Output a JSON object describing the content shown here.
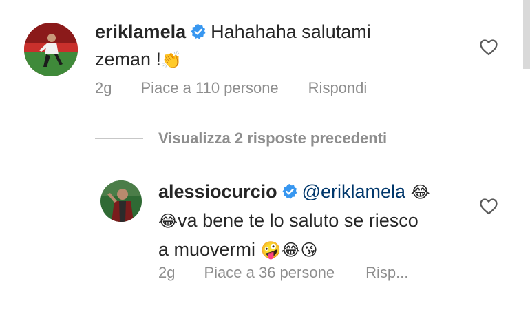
{
  "comments": [
    {
      "username": "eriklamela",
      "verified": true,
      "text_line1": "Hahahaha salutami",
      "text_line2": "zeman !",
      "emoji_line2": "👏",
      "time": "2g",
      "likes": "Piace a 110 persone",
      "reply": "Rispondi"
    }
  ],
  "view_replies": "Visualizza 2 risposte precedenti",
  "reply": {
    "username": "alessiocurcio",
    "verified": true,
    "mention": "@eriklamela",
    "emoji_after_mention": "😂",
    "emoji_line2_start": "😂",
    "text_line2": "va bene te lo saluto se riesco",
    "text_line3": "a muovermi",
    "emoji_line3": "🤪😂😘",
    "time": "2g",
    "likes": "Piace a 36 persone",
    "reply": "Risp..."
  },
  "colors": {
    "verified": "#3897f0",
    "meta": "#8e8e8e",
    "mention": "#00376b"
  },
  "icons": [
    "verified-badge-icon",
    "heart-icon"
  ]
}
